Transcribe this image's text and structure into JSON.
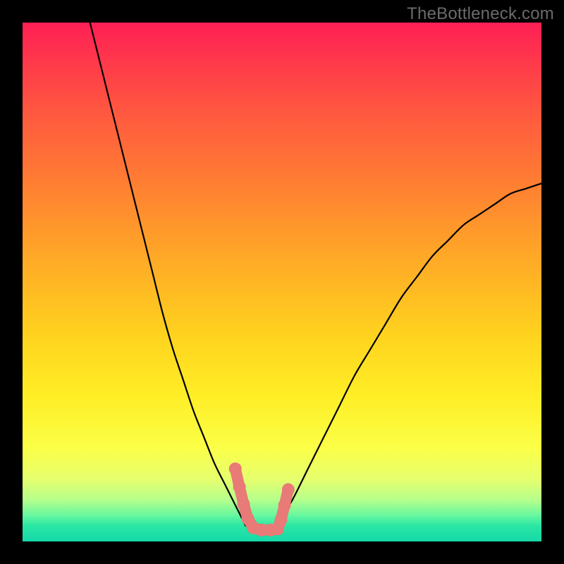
{
  "watermark": "TheBottleneck.com",
  "chart_data": {
    "type": "line",
    "title": "",
    "xlabel": "",
    "ylabel": "",
    "xlim": [
      0,
      100
    ],
    "ylim": [
      0,
      100
    ],
    "grid": false,
    "legend": false,
    "series": [
      {
        "name": "left-curve",
        "color": "#000000",
        "x": [
          13,
          15,
          17,
          19,
          21,
          23,
          25,
          27,
          29,
          31,
          33,
          35,
          37,
          39,
          41,
          43
        ],
        "y": [
          100,
          92,
          84,
          76,
          68,
          60,
          52,
          44,
          37,
          31,
          25,
          20,
          15,
          11,
          7,
          3
        ]
      },
      {
        "name": "right-curve",
        "color": "#000000",
        "x": [
          49,
          52,
          55,
          58,
          61,
          64,
          67,
          70,
          73,
          76,
          79,
          82,
          85,
          88,
          91,
          94,
          97,
          100
        ],
        "y": [
          3,
          8,
          14,
          20,
          26,
          32,
          37,
          42,
          47,
          51,
          55,
          58,
          61,
          63,
          65,
          67,
          68,
          69
        ]
      },
      {
        "name": "highlight-segment",
        "color": "#e87a77",
        "thick": true,
        "points": [
          {
            "x": 41.0,
            "y": 14.0
          },
          {
            "x": 41.8,
            "y": 10.5
          },
          {
            "x": 42.6,
            "y": 7.2
          },
          {
            "x": 43.4,
            "y": 4.4
          },
          {
            "x": 44.5,
            "y": 2.6
          },
          {
            "x": 46.0,
            "y": 2.2
          },
          {
            "x": 47.8,
            "y": 2.2
          },
          {
            "x": 49.2,
            "y": 2.4
          },
          {
            "x": 49.8,
            "y": 4.2
          },
          {
            "x": 50.5,
            "y": 7.0
          },
          {
            "x": 51.2,
            "y": 10.0
          }
        ]
      }
    ]
  }
}
